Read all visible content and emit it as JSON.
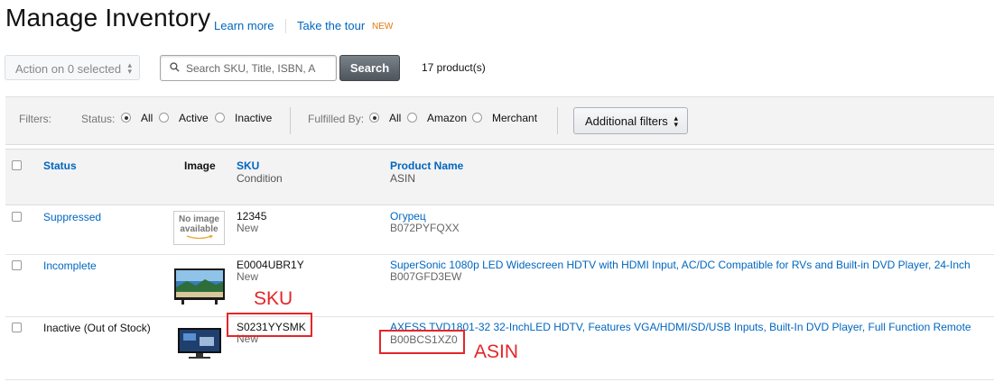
{
  "header": {
    "title": "Manage Inventory",
    "learn_more": "Learn more",
    "take_tour": "Take the tour",
    "new_badge": "NEW"
  },
  "toolbar": {
    "action_select": "Action on 0 selected",
    "search_placeholder": "Search SKU, Title, ISBN, A",
    "search_button": "Search",
    "product_count": "17 product(s)"
  },
  "filters": {
    "label": "Filters:",
    "status_label": "Status:",
    "status_options": [
      "All",
      "Active",
      "Inactive"
    ],
    "status_selected": "All",
    "fulfilled_label": "Fulfilled By:",
    "fulfilled_options": [
      "All",
      "Amazon",
      "Merchant"
    ],
    "fulfilled_selected": "All",
    "additional_filters": "Additional filters"
  },
  "table": {
    "headers": {
      "status": "Status",
      "image": "Image",
      "sku": "SKU",
      "condition": "Condition",
      "product_name": "Product Name",
      "asin": "ASIN"
    },
    "rows": [
      {
        "status": "Suppressed",
        "image": "no-image",
        "no_image_text": "No image available",
        "sku": "12345",
        "condition": "New",
        "product_name": "Огурец",
        "asin": "B072PYFQXX"
      },
      {
        "status": "Incomplete",
        "image": "tv-thumbnail",
        "sku": "E0004UBR1Y",
        "condition": "New",
        "product_name": "SuperSonic 1080p LED Widescreen HDTV with HDMI Input, AC/DC Compatible for RVs and Built-in DVD Player, 24-Inch",
        "asin": "B007GFD3EW"
      },
      {
        "status": "Inactive (Out of Stock)",
        "image": "tv-thumbnail",
        "sku": "S0231YYSMK",
        "condition": "New",
        "product_name": "AXESS TVD1801-32 32-InchLED HDTV, Features VGA/HDMI/SD/USB Inputs, Built-In DVD Player, Full Function Remote",
        "asin": "B00BCS1XZ0"
      }
    ]
  },
  "annotations": {
    "sku_label": "SKU",
    "asin_label": "ASIN",
    "color": "#e3262a"
  },
  "colors": {
    "link": "#0066c0",
    "new_badge": "#e47911"
  }
}
